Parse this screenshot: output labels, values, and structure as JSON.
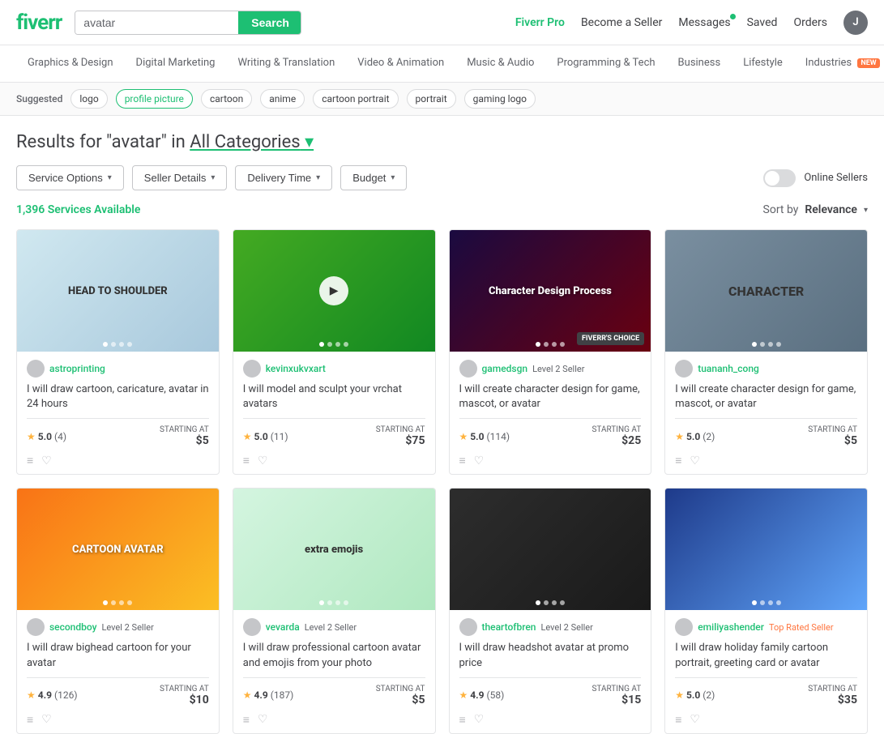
{
  "header": {
    "logo": "fiverr",
    "search_placeholder": "avatar",
    "search_value": "avatar",
    "search_button": "Search",
    "fiverr_pro": "Fiverr Pro",
    "become_seller": "Become a Seller",
    "messages": "Messages",
    "saved": "Saved",
    "orders": "Orders",
    "user_initial": "J"
  },
  "nav": {
    "items": [
      {
        "label": "Graphics & Design"
      },
      {
        "label": "Digital Marketing"
      },
      {
        "label": "Writing & Translation"
      },
      {
        "label": "Video & Animation"
      },
      {
        "label": "Music & Audio"
      },
      {
        "label": "Programming & Tech"
      },
      {
        "label": "Business"
      },
      {
        "label": "Lifestyle"
      },
      {
        "label": "Industries",
        "badge": "NEW"
      }
    ]
  },
  "suggested": {
    "label": "Suggested",
    "tags": [
      "logo",
      "profile picture",
      "cartoon",
      "anime",
      "cartoon portrait",
      "portrait",
      "gaming logo"
    ]
  },
  "results": {
    "query": "avatar",
    "category": "All Categories",
    "heading_prefix": "Results for \"avatar\" in"
  },
  "filters": {
    "service_options": "Service Options",
    "seller_details": "Seller Details",
    "delivery_time": "Delivery Time",
    "budget": "Budget",
    "online_sellers": "Online Sellers"
  },
  "sort": {
    "label": "Sort by",
    "value": "Relevance"
  },
  "count": "1,396 Services Available",
  "cards": [
    {
      "id": 1,
      "seller": "astroprinting",
      "level": "",
      "title": "I will draw cartoon, caricature, avatar in 24 hours",
      "rating": "5.0",
      "reviews": "4",
      "price": "$5",
      "starting_at": "STARTING AT",
      "fiverr_choice": false,
      "bg": "img-1",
      "label": "HEAD TO SHOULDER"
    },
    {
      "id": 2,
      "seller": "kevinxukvxart",
      "level": "",
      "title": "I will model and sculpt your vrchat avatars",
      "rating": "5.0",
      "reviews": "11",
      "price": "$75",
      "starting_at": "STARTING AT",
      "fiverr_choice": false,
      "bg": "img-2",
      "label": ""
    },
    {
      "id": 3,
      "seller": "gamedsgn",
      "level": "Level 2 Seller",
      "title": "I will create character design for game, mascot, or avatar",
      "rating": "5.0",
      "reviews": "114",
      "price": "$25",
      "starting_at": "STARTING AT",
      "fiverr_choice": true,
      "bg": "img-3",
      "label": "Character Design Process"
    },
    {
      "id": 4,
      "seller": "tuananh_cong",
      "level": "",
      "title": "I will create character design for game, mascot, or avatar",
      "rating": "5.0",
      "reviews": "2",
      "price": "$5",
      "starting_at": "STARTING AT",
      "fiverr_choice": false,
      "bg": "img-4",
      "label": "CHARACTER"
    },
    {
      "id": 5,
      "seller": "secondboy",
      "level": "Level 2 Seller",
      "title": "I will draw bighead cartoon for your avatar",
      "rating": "4.9",
      "reviews": "126",
      "price": "$10",
      "starting_at": "STARTING AT",
      "fiverr_choice": false,
      "bg": "img-5",
      "label": "CARTOON AVATAR"
    },
    {
      "id": 6,
      "seller": "vevarda",
      "level": "Level 2 Seller",
      "title": "I will draw professional cartoon avatar and emojis from your photo",
      "rating": "4.9",
      "reviews": "187",
      "price": "$5",
      "starting_at": "STARTING AT",
      "fiverr_choice": false,
      "bg": "img-6",
      "label": "extra emojis"
    },
    {
      "id": 7,
      "seller": "theartofbren",
      "level": "Level 2 Seller",
      "title": "I will draw headshot avatar at promo price",
      "rating": "4.9",
      "reviews": "58",
      "price": "$15",
      "starting_at": "STARTING AT",
      "fiverr_choice": false,
      "bg": "img-7",
      "label": ""
    },
    {
      "id": 8,
      "seller": "emiliyashender",
      "level": "Top Rated Seller",
      "title": "I will draw holiday family cartoon portrait, greeting card or avatar",
      "rating": "5.0",
      "reviews": "2",
      "price": "$35",
      "starting_at": "STARTING AT",
      "fiverr_choice": false,
      "bg": "img-8",
      "label": ""
    }
  ]
}
